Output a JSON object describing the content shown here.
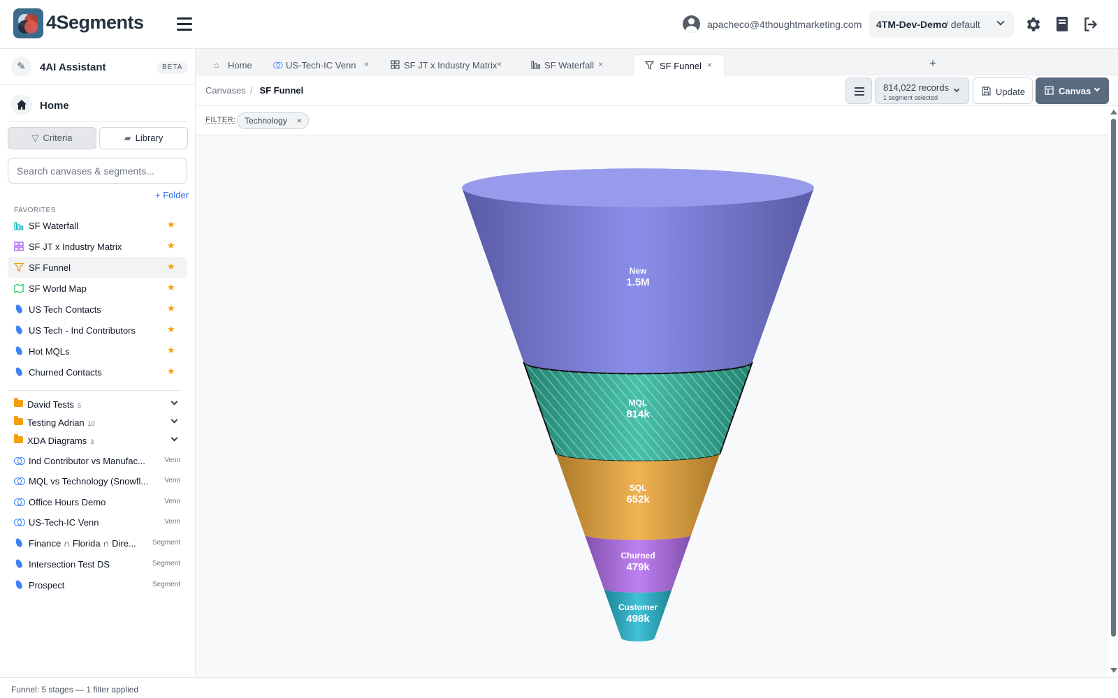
{
  "app": {
    "brand": "4Segments",
    "user_email": "apacheco@4thoughtmarketing.com",
    "org": "4TM-Dev-Demo",
    "org_sub": "/ default"
  },
  "sidebar": {
    "ai": {
      "label": "4AI Assistant",
      "badge": "BETA"
    },
    "home_label": "Home",
    "criteria_label": "Criteria",
    "library_label": "Library",
    "search_placeholder": "Search canvases & segments...",
    "add_folder": "+ Folder",
    "favorites_title": "FAVORITES",
    "favorites": [
      {
        "label": "SF Waterfall",
        "icon": "bar-chart-icon",
        "starred": true
      },
      {
        "label": "SF JT x Industry Matrix",
        "icon": "grid-icon",
        "starred": true
      },
      {
        "label": "SF Funnel",
        "icon": "funnel-icon",
        "starred": true,
        "active": true
      },
      {
        "label": "SF World Map",
        "icon": "map-icon",
        "starred": true
      },
      {
        "label": "US Tech Contacts",
        "icon": "segment-drop-icon",
        "starred": true
      },
      {
        "label": "US Tech - Ind Contributors",
        "icon": "segment-drop-icon",
        "starred": true
      },
      {
        "label": "Hot MQLs",
        "icon": "segment-drop-icon",
        "starred": true
      },
      {
        "label": "Churned Contacts",
        "icon": "segment-drop-icon",
        "starred": true
      }
    ],
    "star_glyph": "★",
    "folders": [
      {
        "label": "David Tests",
        "count": "5"
      },
      {
        "label": "Testing Adrian",
        "count": "10"
      },
      {
        "label": "XDA Diagrams",
        "count": "3"
      }
    ],
    "items": [
      {
        "label": "Ind Contributor vs Manufac...",
        "type": "Venn",
        "icon": "venn-icon"
      },
      {
        "label": "MQL vs Technology (Snowfl...",
        "type": "Venn",
        "icon": "venn-icon"
      },
      {
        "label": "Office Hours Demo",
        "type": "Venn",
        "icon": "venn-icon"
      },
      {
        "label": "US-Tech-IC Venn",
        "type": "Venn",
        "icon": "venn-icon"
      },
      {
        "label": "Finance ∩ Florida ∩ Dire...",
        "type": "Segment",
        "icon": "segment-drop-icon"
      },
      {
        "label": "Intersection Test DS",
        "type": "Segment",
        "icon": "segment-drop-icon"
      },
      {
        "label": "Prospect",
        "type": "Segment",
        "icon": "segment-drop-icon"
      }
    ]
  },
  "tabs": [
    {
      "label": "Home",
      "icon": "home-icon",
      "closable": false
    },
    {
      "label": "US-Tech-IC Venn",
      "icon": "venn-icon",
      "closable": true
    },
    {
      "label": "SF JT x Industry Matrix",
      "icon": "grid-icon",
      "closable": true
    },
    {
      "label": "SF Waterfall",
      "icon": "bar-chart-icon",
      "closable": true
    },
    {
      "label": "SF Funnel",
      "icon": "funnel-icon",
      "closable": true,
      "active": true
    }
  ],
  "close_glyph": "×",
  "add_tab_glyph": "+",
  "toolbar": {
    "breadcrumb_root": "Canvases",
    "breadcrumb_sep": "/",
    "breadcrumb_current": "SF Funnel",
    "records_label": "814,022 records",
    "records_sub": "1 segment selected",
    "update_label": "Update",
    "canvas_label": "Canvas"
  },
  "filter": {
    "label": "FILTER:",
    "chips": [
      "Technology"
    ]
  },
  "status_text": "Funnel: 5 stages — 1 filter applied",
  "colors": {
    "new": "#7b7fe6",
    "mql": "#2eb79e",
    "sql": "#eea93a",
    "churned": "#b66ff0",
    "customer": "#27b8d0",
    "accent": "#5a6b80"
  },
  "chart_data": {
    "type": "funnel",
    "stages": [
      {
        "name": "New",
        "value": "1.5M",
        "color": "#7b7fe6"
      },
      {
        "name": "MQL",
        "value": "814k",
        "color": "#2eb79e",
        "selected": true
      },
      {
        "name": "SQL",
        "value": "652k",
        "color": "#eea93a"
      },
      {
        "name": "Churned",
        "value": "479k",
        "color": "#b66ff0"
      },
      {
        "name": "Customer",
        "value": "498k",
        "color": "#27b8d0"
      }
    ]
  }
}
